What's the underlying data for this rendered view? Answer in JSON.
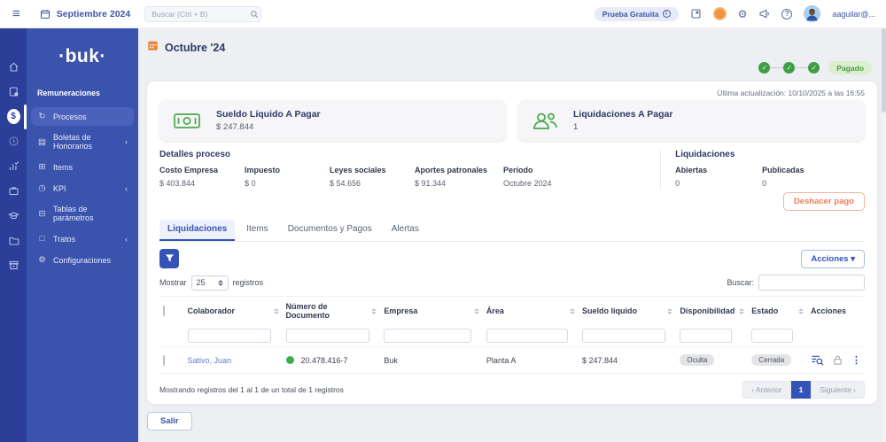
{
  "icons": {
    "hamburger": "≡",
    "check": "✓",
    "caret_down": "▾",
    "chevron_collapse": "‹",
    "dots_vertical": "⋮",
    "gear": "⚙",
    "help": "?",
    "info": "i",
    "dollar": "$",
    "menu_procesos": "↻",
    "menu_boletas": "▤",
    "menu_items": "⊞",
    "menu_kpi": "◷",
    "menu_tablas": "⊟",
    "menu_tratos": "□",
    "menu_config": "⚙"
  },
  "topbar": {
    "period": "Septiembre 2024",
    "search_placeholder": "Buscar (Ctrl + B)",
    "trial_badge": "Prueba Gratuita",
    "user_email": "aaguilar@..."
  },
  "sidebar": {
    "logo": "·buk·",
    "section": "Remuneraciones",
    "items": [
      {
        "label": "Procesos"
      },
      {
        "label": "Boletas de Honorarios"
      },
      {
        "label": "Items"
      },
      {
        "label": "KPI"
      },
      {
        "label": "Tablas de parámetros"
      },
      {
        "label": "Tratos"
      },
      {
        "label": "Configuraciones"
      }
    ]
  },
  "main": {
    "title": "Octubre '24",
    "status_badge": "Pagado",
    "last_update": "Última actualización: 10/10/2025 a las 16:55",
    "cards": [
      {
        "title": "Sueldo Líquido A Pagar",
        "value": "$ 247.844"
      },
      {
        "title": "Liquidaciones A Pagar",
        "value": "1"
      }
    ],
    "details": {
      "title": "Detalles proceso",
      "fields": [
        {
          "label": "Costo Empresa",
          "value": "$ 403.844"
        },
        {
          "label": "Impuesto",
          "value": "$ 0"
        },
        {
          "label": "Leyes sociales",
          "value": "$ 54.656"
        },
        {
          "label": "Aportes patronales",
          "value": "$ 91.344"
        },
        {
          "label": "Período",
          "value": "Octubre 2024"
        }
      ]
    },
    "liquidaciones": {
      "title": "Liquidaciones",
      "fields": [
        {
          "label": "Abiertas",
          "value": "0"
        },
        {
          "label": "Publicadas",
          "value": "0"
        }
      ],
      "undo_button": "Deshacer pago"
    },
    "tabs": [
      {
        "label": "Liquidaciones"
      },
      {
        "label": "Items"
      },
      {
        "label": "Documentos y Pagos"
      },
      {
        "label": "Alertas"
      }
    ],
    "controls": {
      "actions_button": "Acciones",
      "show_label": "Mostrar",
      "page_size": "25",
      "records_label": "registros",
      "search_label": "Buscar:"
    },
    "table": {
      "columns": [
        {
          "label": "Colaborador"
        },
        {
          "label": "Número de Documento"
        },
        {
          "label": "Empresa"
        },
        {
          "label": "Área"
        },
        {
          "label": "Sueldo líquido"
        },
        {
          "label": "Disponibilidad"
        },
        {
          "label": "Estado"
        },
        {
          "label": "Acciones"
        }
      ],
      "row": {
        "colaborador": "Sativo, Juan",
        "documento": "20.478.416-7",
        "empresa": "Buk",
        "area": "Planta A",
        "sueldo": "$ 247.844",
        "disponibilidad": "Oculta",
        "estado": "Cerrada"
      },
      "footer": "Mostrando registros del 1 al 1 de un total de 1 registros",
      "pagination": {
        "prev": "‹ Anterior",
        "page": "1",
        "next": "Siguiente ›"
      }
    },
    "exit_button": "Salir"
  },
  "colors": {
    "sidebar_rail": "#2b3f99",
    "sidebar_panel": "#3a53ad",
    "accent_blue": "#3353b7",
    "success_green": "#3f9e43",
    "warning_orange": "#ec7f5c",
    "paid_badge_bg": "#d9efcf"
  }
}
